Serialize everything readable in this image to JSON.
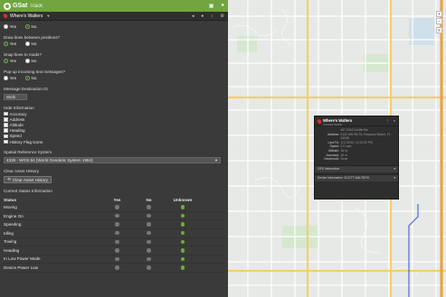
{
  "app": {
    "logo": "GSat",
    "logo_sub": "Track"
  },
  "panel": {
    "title": "Where's Walters",
    "radio_top": [
      {
        "label": "Yes",
        "on": false
      },
      {
        "label": "No",
        "on": true
      }
    ],
    "q_erase": {
      "label": "Draw lines between positions?",
      "options": [
        {
          "label": "Yes",
          "on": true
        },
        {
          "label": "No",
          "on": false
        }
      ]
    },
    "q_snap": {
      "label": "Snap lines to roads?",
      "options": [
        {
          "label": "Yes",
          "on": true
        },
        {
          "label": "No",
          "on": false
        }
      ]
    },
    "q_popup": {
      "label": "Pop-up incoming text messages?",
      "options": [
        {
          "label": "Yes",
          "on": false
        },
        {
          "label": "No",
          "on": true
        }
      ]
    },
    "msg_dest": {
      "label": "Message Destination ID",
      "value": "Walk"
    },
    "hide_info": {
      "label": "Hide Information",
      "items": [
        "Accuracy",
        "Address",
        "Altitude",
        "Heading",
        "Speed",
        "History Flag Icons"
      ]
    },
    "srs": {
      "label": "Spatial Reference System",
      "value": "4326 - WGS 84 (World Geodetic System 1984)"
    },
    "clear_history": {
      "label": "Clear Asset History",
      "button": "Clear Asset History"
    },
    "status": {
      "label": "Current Status Information",
      "headers": [
        "Status",
        "Yes",
        "No",
        "Unknown"
      ],
      "rows": [
        "Moving",
        "Engine On",
        "Speeding",
        "Idling",
        "Towing",
        "Heading",
        "In Low Power Mode",
        "Device Power Low"
      ]
    }
  },
  "popup": {
    "title": "Where's Walters",
    "subtitle": "Compact Vehicle",
    "fields": [
      {
        "k": "",
        "v": "467-5302 DeWitt Ble"
      },
      {
        "k": "Address:",
        "v": "6150 NW 9th St, Pompano Beach, FL 33068"
      },
      {
        "k": "Last Fix:",
        "v": "1/17/2020, 12:24:00 PM"
      },
      {
        "k": "Speed:",
        "v": "0.0 mph"
      },
      {
        "k": "Altitude:",
        "v": "16 m"
      },
      {
        "k": "Accuracy:",
        "v": "18 m"
      },
      {
        "k": "Geofences:",
        "v": "None"
      }
    ],
    "bar1": "GPS Information",
    "bar2": "Device Information: SCOTT WALTERS"
  },
  "colors": {
    "brand": "#70a53f",
    "panel": "#3a3a3a",
    "map_bg": "#e7e9e6"
  }
}
